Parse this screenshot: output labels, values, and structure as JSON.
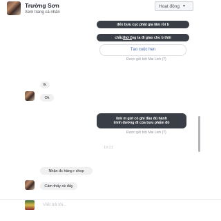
{
  "header": {
    "name": "Trường Sơn",
    "profile_link": "Xem trang cá nhân",
    "status_label": "Hoạt động"
  },
  "messages": {
    "out1": "đến bưu cục phát gia lâm rồi b",
    "out2_prefix": "chắc ",
    "out2_link": "thứ 2",
    "out2_suffix": " ng ta đi giao cho b thôi",
    "card_link": "Tạo cuộc hẹn",
    "sent_by_1": "Được gửi bởi Mai Linh (?)",
    "in1": "lk",
    "in2": "Ok",
    "out3_line1": "link m gửi có ghi đầu đủ hành",
    "out3_line2": "trình đường đi của bưu phẩm đó",
    "sent_by_2": "Được gửi bởi Mai Linh (?)",
    "timestamp": "19:21",
    "in3": "Nhận đc hàng r shop",
    "in4": "Cảm thấy ok đấy"
  },
  "composer": {
    "placeholder": "Viết trả lời..."
  },
  "colors": {
    "dark_bubble": "#3a3f47",
    "light_bubble": "#f1f0f0",
    "link": "#4267b2"
  }
}
